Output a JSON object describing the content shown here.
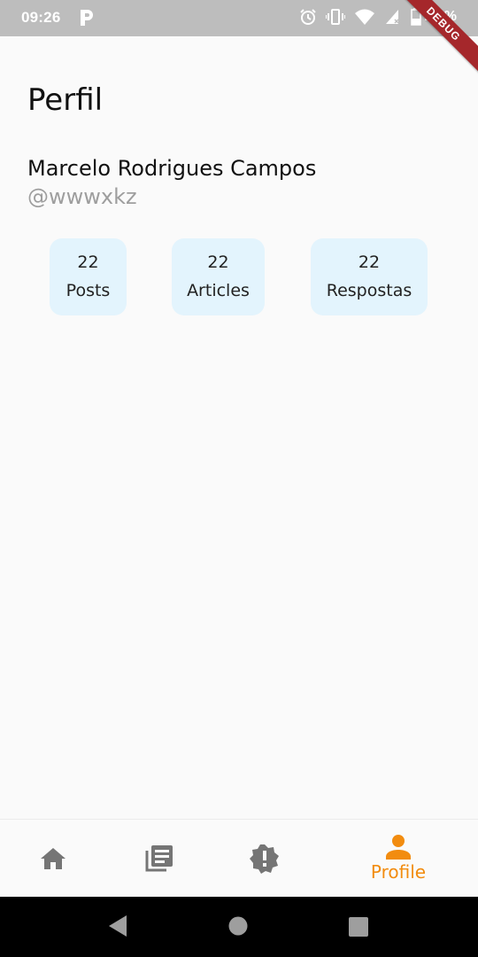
{
  "status_bar": {
    "time": "09:26",
    "battery_text": "22 %",
    "debug_label": "DEBUG",
    "icons": [
      "p-icon",
      "alarm-icon",
      "vibrate-icon",
      "wifi-icon",
      "signal-icon",
      "battery-icon"
    ]
  },
  "page": {
    "title": "Perfil"
  },
  "user": {
    "name": "Marcelo Rodrigues Campos",
    "handle": "@wwwxkz"
  },
  "stats": [
    {
      "count": "22",
      "label": "Posts"
    },
    {
      "count": "22",
      "label": "Articles"
    },
    {
      "count": "22",
      "label": "Respostas"
    }
  ],
  "bottom_nav": {
    "items": [
      {
        "icon": "home-icon",
        "label": ""
      },
      {
        "icon": "articles-icon",
        "label": ""
      },
      {
        "icon": "alert-badge-icon",
        "label": ""
      },
      {
        "icon": "person-icon",
        "label": "Profile",
        "active": true
      }
    ],
    "active_color": "#f28c0f",
    "inactive_color": "#757575"
  },
  "system_nav": {
    "buttons": [
      "back-icon",
      "home-circle-icon",
      "recents-icon"
    ]
  },
  "colors": {
    "status_bar": "#bdbdbd",
    "background": "#fafafa",
    "stat_card": "#e3f4fd",
    "handle_text": "#9e9e9e",
    "debug_banner": "#a5272b"
  }
}
